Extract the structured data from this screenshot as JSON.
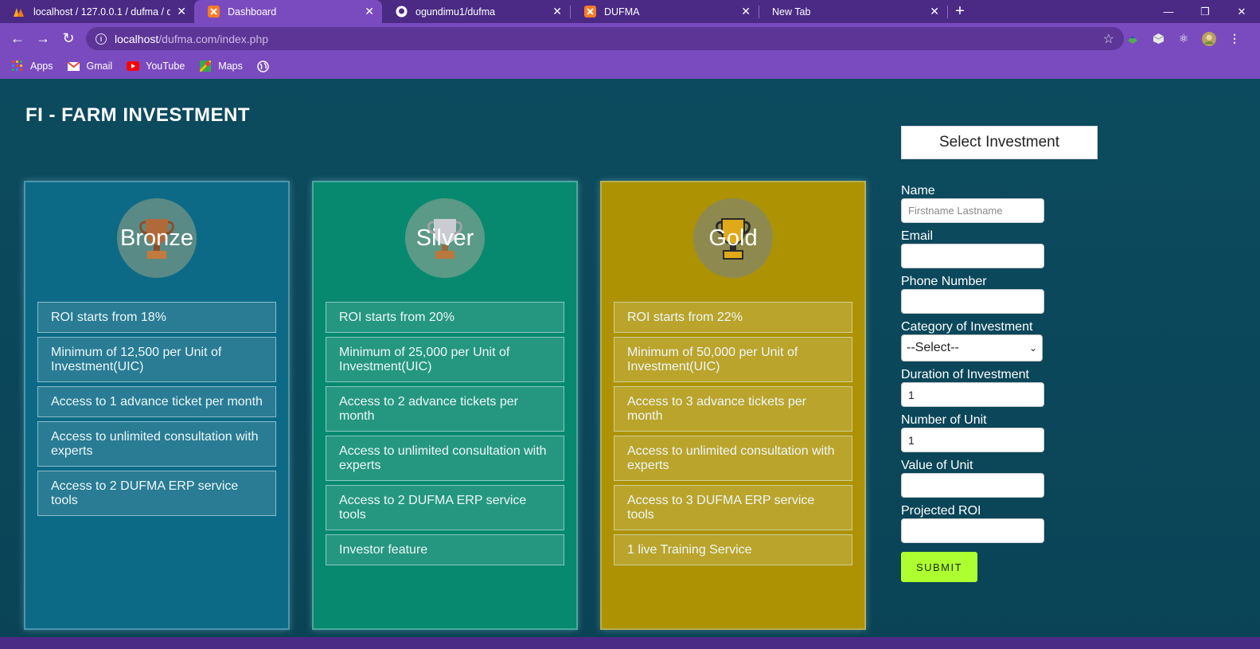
{
  "browser": {
    "tabs": [
      {
        "title": "localhost / 127.0.0.1 / dufma / du",
        "icon": "phpmyadmin-icon",
        "active": false
      },
      {
        "title": "Dashboard",
        "icon": "xampp-icon",
        "active": true
      },
      {
        "title": "ogundimu1/dufma",
        "icon": "github-icon",
        "active": false
      },
      {
        "title": "DUFMA",
        "icon": "xampp-icon",
        "active": false
      },
      {
        "title": "New Tab",
        "icon": "",
        "active": false
      }
    ],
    "url_host": "localhost",
    "url_path": "/dufma.com/index.php",
    "bookmarks": [
      {
        "label": "Apps",
        "icon": "apps-grid-icon"
      },
      {
        "label": "Gmail",
        "icon": "gmail-icon"
      },
      {
        "label": "YouTube",
        "icon": "youtube-icon"
      },
      {
        "label": "Maps",
        "icon": "maps-icon"
      },
      {
        "label": "",
        "icon": "globe-icon"
      }
    ]
  },
  "page": {
    "title": "FI - FARM INVESTMENT"
  },
  "plans": [
    {
      "name": "Bronze",
      "color": "#0c6a86",
      "features": [
        "ROI starts from 18%",
        "Minimum of 12,500 per Unit of Investment(UIC)",
        "Access to 1 advance ticket per month",
        "Access to unlimited consultation with experts",
        "Access to 2 DUFMA ERP service tools"
      ]
    },
    {
      "name": "Silver",
      "color": "#07896f",
      "features": [
        "ROI starts from 20%",
        "Minimum of 25,000 per Unit of Investment(UIC)",
        "Access to 2 advance tickets per month",
        "Access to unlimited consultation with experts",
        "Access to 2 DUFMA ERP service tools",
        "Investor feature"
      ]
    },
    {
      "name": "Gold",
      "color": "#ad9303",
      "features": [
        "ROI starts from 22%",
        "Minimum of 50,000 per Unit of Investment(UIC)",
        "Access to 3 advance tickets per month",
        "Access to unlimited consultation with experts",
        "Access to 3 DUFMA ERP service tools",
        "1 live Training Service"
      ]
    }
  ],
  "form": {
    "heading": "Select Investment",
    "name_label": "Name",
    "name_placeholder": "Firstname Lastname",
    "email_label": "Email",
    "phone_label": "Phone Number",
    "category_label": "Category of Investment",
    "category_value": "--Select--",
    "duration_label": "Duration of Investment",
    "duration_value": "1",
    "units_label": "Number of Unit",
    "units_value": "1",
    "unit_value_label": "Value of Unit",
    "roi_label": "Projected ROI",
    "submit_label": "SUBMIT",
    "submit_color": "#adff2f"
  }
}
